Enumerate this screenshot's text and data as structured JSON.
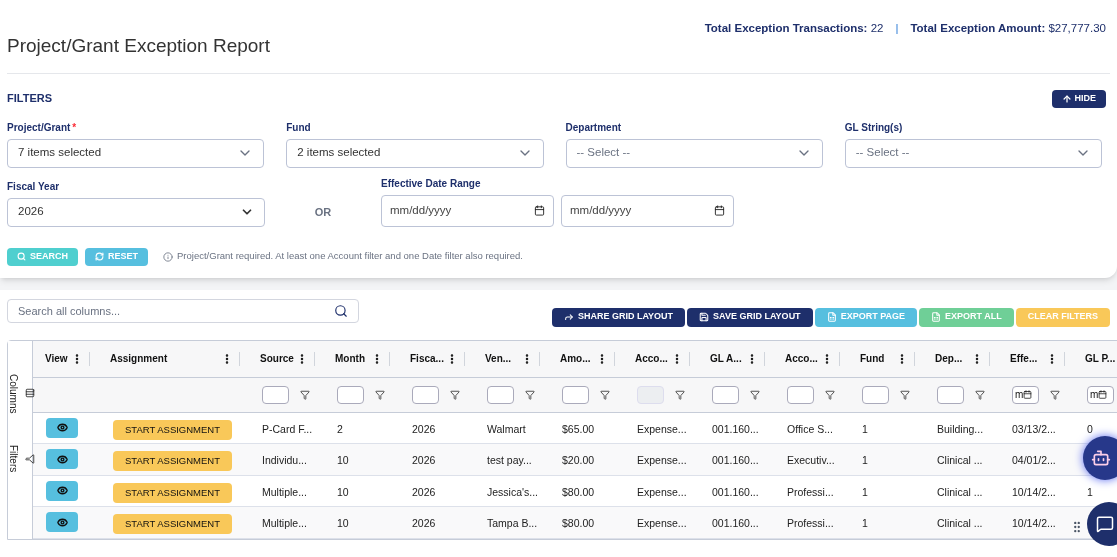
{
  "header": {
    "title": "Project/Grant Exception Report",
    "totals": [
      {
        "label": "Total Exception Transactions:",
        "value": "22"
      },
      {
        "label": "Total Exception Amount:",
        "value": "$27,777.30"
      }
    ],
    "separator": "|"
  },
  "filters": {
    "title": "FILTERS",
    "hide_button": "HIDE",
    "fields": [
      {
        "kind": "multiselect",
        "label": "Project/Grant",
        "required_mark": "*",
        "value": "7 items selected"
      },
      {
        "kind": "multiselect",
        "label": "Fund",
        "value": "2 items selected"
      },
      {
        "kind": "multiselect",
        "label": "Department",
        "placeholder": "-- Select --"
      },
      {
        "kind": "multiselect",
        "label": "GL String(s)",
        "placeholder": "-- Select --"
      }
    ],
    "fiscal_year": {
      "label": "Fiscal Year",
      "value": "2026"
    },
    "or_label": "OR",
    "date_range": {
      "label": "Effective Date Range",
      "from_placeholder": "mm/dd/yyyy",
      "to_placeholder": "mm/dd/yyyy"
    },
    "buttons": [
      {
        "kind": "search",
        "label": "SEARCH"
      },
      {
        "kind": "reset",
        "label": "RESET"
      }
    ],
    "note": "Project/Grant required. At least one Account filter and one Date filter also required."
  },
  "toolbar": {
    "search_placeholder": "Search all columns...",
    "buttons": [
      {
        "kind": "share",
        "label": "SHARE GRID LAYOUT"
      },
      {
        "kind": "save",
        "label": "SAVE GRID LAYOUT"
      },
      {
        "kind": "export_page",
        "label": "EXPORT PAGE"
      },
      {
        "kind": "export_all",
        "label": "EXPORT ALL"
      },
      {
        "kind": "clear",
        "label": "CLEAR FILTERS"
      }
    ]
  },
  "side_tabs": [
    {
      "kind": "columns",
      "label": "Columns"
    },
    {
      "kind": "filters",
      "label": "Filters"
    }
  ],
  "grid": {
    "fixed_columns": [
      {
        "label": "View"
      },
      {
        "label": "Assignment"
      }
    ],
    "columns": [
      {
        "label": "Source",
        "kind": "text"
      },
      {
        "label": "Month",
        "kind": "text"
      },
      {
        "label": "Fisca...",
        "kind": "text"
      },
      {
        "label": "Ven...",
        "kind": "text"
      },
      {
        "label": "Amo...",
        "kind": "text"
      },
      {
        "label": "Acco...",
        "kind": "disabled"
      },
      {
        "label": "GL A...",
        "kind": "text"
      },
      {
        "label": "Acco...",
        "kind": "text"
      },
      {
        "label": "Fund",
        "kind": "text"
      },
      {
        "label": "Dep...",
        "kind": "text"
      },
      {
        "label": "Effe...",
        "kind": "date",
        "filter_text": "m"
      },
      {
        "label": "GL P...",
        "kind": "date",
        "filter_text": "m"
      }
    ],
    "rows": [
      {
        "action": "START ASSIGNMENT",
        "cells": [
          "P-Card F...",
          "2",
          "2026",
          "Walmart",
          "$65.00",
          "Expense...",
          "001.160...",
          "Office S...",
          "1",
          "Building...",
          "03/13/2...",
          "0"
        ]
      },
      {
        "action": "START ASSIGNMENT",
        "cells": [
          "Individu...",
          "10",
          "2026",
          "test pay...",
          "$20.00",
          "Expense...",
          "001.160...",
          "Executiv...",
          "1",
          "Clinical ...",
          "04/01/2..."
        ]
      },
      {
        "action": "START ASSIGNMENT",
        "cells": [
          "Multiple...",
          "10",
          "2026",
          "Jessica's...",
          "$80.00",
          "Expense...",
          "001.160...",
          "Professi...",
          "1",
          "Clinical ...",
          "10/14/2...",
          "1"
        ]
      },
      {
        "action": "START ASSIGNMENT",
        "cells": [
          "Multiple...",
          "10",
          "2026",
          "Tampa B...",
          "$80.00",
          "Expense...",
          "001.160...",
          "Professi...",
          "1",
          "Clinical ...",
          "10/14/2..."
        ]
      }
    ]
  }
}
